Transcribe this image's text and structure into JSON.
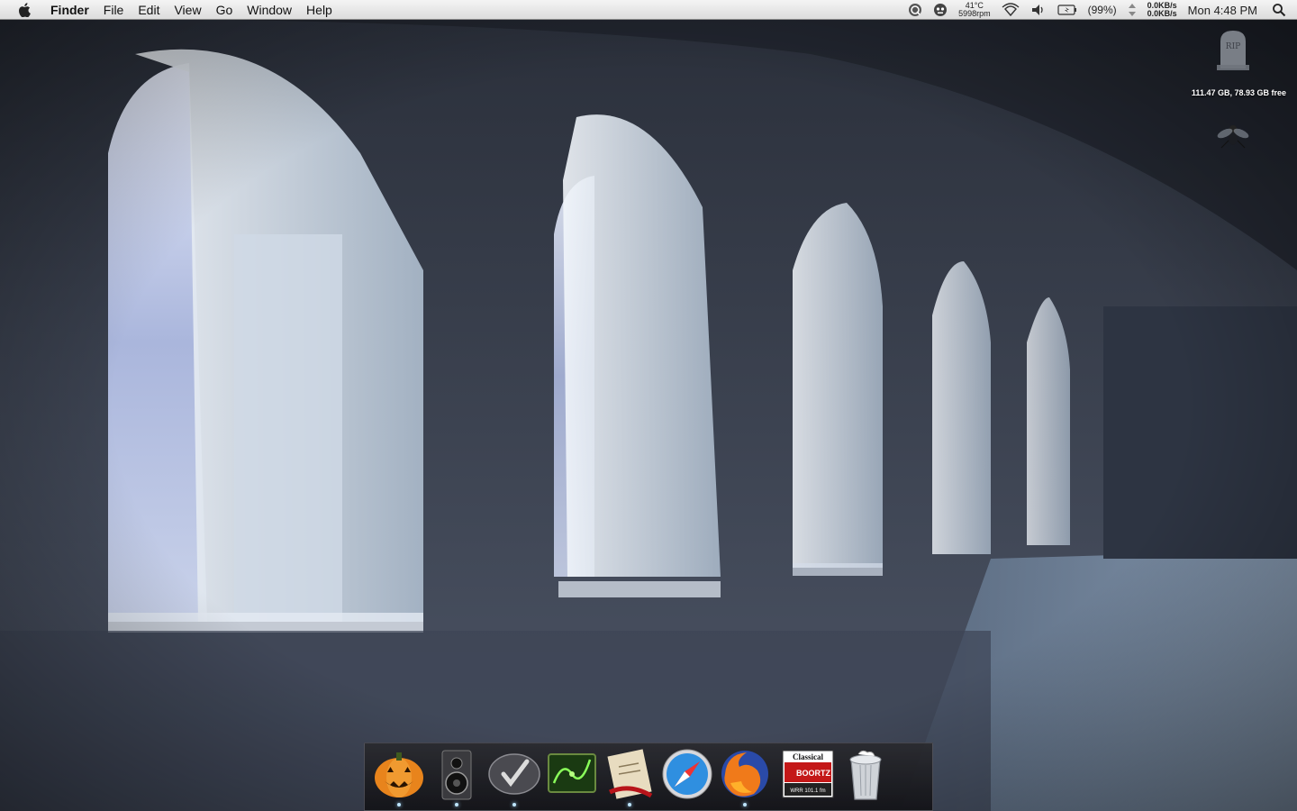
{
  "menubar": {
    "app_name": "Finder",
    "items": [
      "File",
      "Edit",
      "View",
      "Go",
      "Window",
      "Help"
    ],
    "temp": "41°C",
    "fan": "5998rpm",
    "battery": "(99%)",
    "net_up": "0.0KB/s",
    "net_down": "0.0KB/s",
    "clock": "Mon 4:48 PM"
  },
  "widgets": {
    "tomb_text": "RIP",
    "disk": "111.47 GB, 78.93 GB free"
  },
  "dock": {
    "radio_label_1": "Classical",
    "radio_label_2": "BOORTZ",
    "radio_label_3": "WRR 101.1 fm"
  },
  "colors": {
    "menubar": "#dcdcdc",
    "dock": "#1a1a1e",
    "indicator": "#bfe6ff"
  }
}
